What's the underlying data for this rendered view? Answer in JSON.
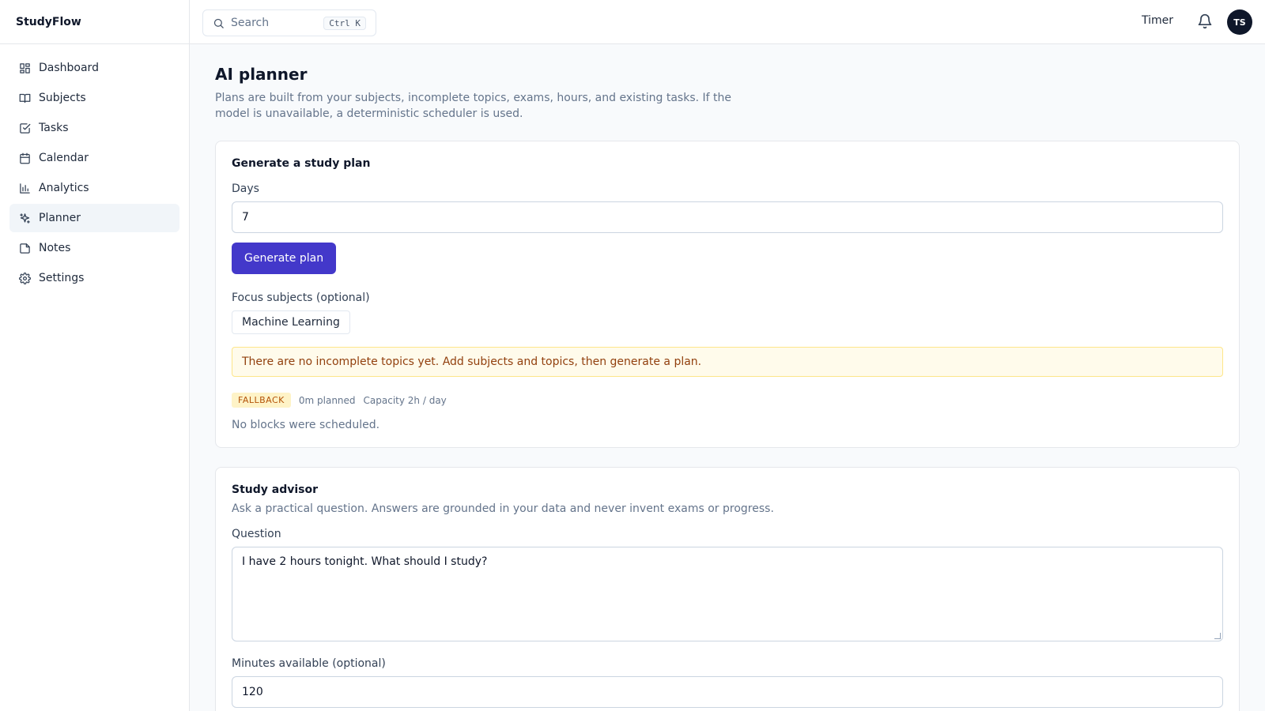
{
  "app": {
    "name": "StudyFlow"
  },
  "sidebar": {
    "items": [
      {
        "label": "Dashboard",
        "icon": "dashboard-icon"
      },
      {
        "label": "Subjects",
        "icon": "book-icon"
      },
      {
        "label": "Tasks",
        "icon": "check-square-icon"
      },
      {
        "label": "Calendar",
        "icon": "calendar-icon"
      },
      {
        "label": "Analytics",
        "icon": "bar-chart-icon"
      },
      {
        "label": "Planner",
        "icon": "sparkles-icon",
        "active": true
      },
      {
        "label": "Notes",
        "icon": "note-icon"
      },
      {
        "label": "Settings",
        "icon": "gear-icon"
      }
    ]
  },
  "topbar": {
    "search_placeholder": "Search",
    "shortcut": "Ctrl K",
    "timer_label": "Timer",
    "avatar_initials": "TS"
  },
  "page": {
    "title": "AI planner",
    "description": "Plans are built from your subjects, incomplete topics, exams, hours, and existing tasks. If the model is unavailable, a deterministic scheduler is used."
  },
  "plan_card": {
    "title": "Generate a study plan",
    "days_label": "Days",
    "days_value": "7",
    "generate_label": "Generate plan",
    "focus_label": "Focus subjects (optional)",
    "focus_chips": [
      "Machine Learning"
    ],
    "alert": "There are no incomplete topics yet. Add subjects and topics, then generate a plan.",
    "badge": "FALLBACK",
    "planned": "0m planned",
    "capacity": "Capacity 2h / day",
    "empty": "No blocks were scheduled."
  },
  "advisor_card": {
    "title": "Study advisor",
    "subtitle": "Ask a practical question. Answers are grounded in your data and never invent exams or progress.",
    "question_label": "Question",
    "question_value": "I have 2 hours tonight. What should I study?",
    "minutes_label": "Minutes available (optional)",
    "minutes_value": "120"
  },
  "colors": {
    "primary": "#4338ca",
    "alert_bg": "#fffbeb",
    "alert_text": "#92400e",
    "badge_text": "#b45309"
  }
}
